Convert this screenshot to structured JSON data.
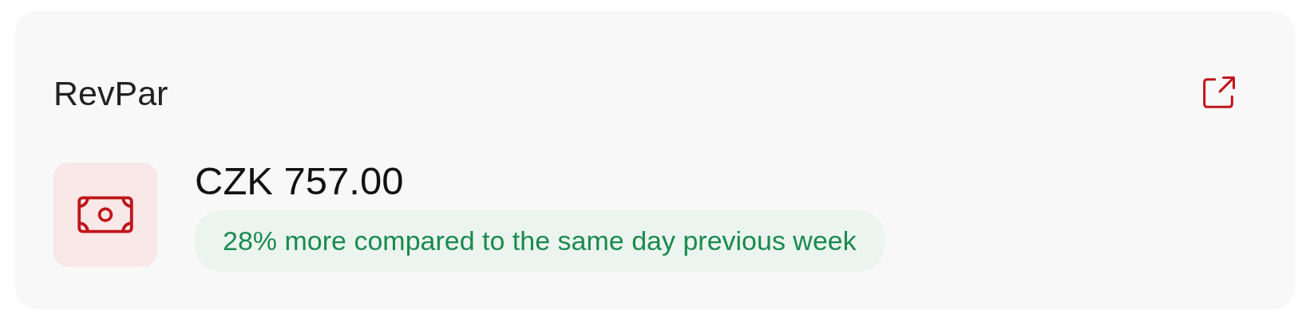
{
  "card": {
    "title": "RevPar",
    "value": "CZK 757.00",
    "comparison": {
      "text": "28% more compared to the same day previous week",
      "positive": true
    }
  }
}
